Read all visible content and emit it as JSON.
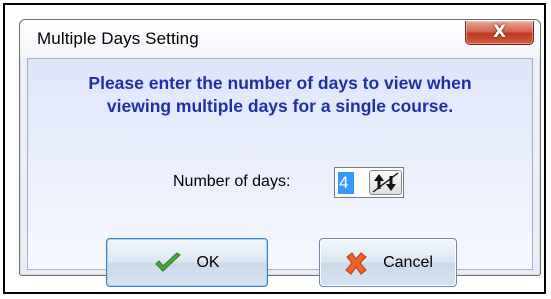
{
  "window": {
    "title": "Multiple Days Setting",
    "close_label": "X"
  },
  "instruction": {
    "line1": "Please enter the number of days to view when",
    "line2": "viewing multiple days for a single course."
  },
  "days": {
    "label": "Number of days:",
    "value": "4"
  },
  "buttons": {
    "ok_label": "OK",
    "cancel_label": "Cancel"
  },
  "icons": {
    "ok": "checkmark-icon",
    "cancel": "x-mark-icon",
    "spinner": "up-down-arrows-icon"
  },
  "colors": {
    "instruction_text": "#1f2fa8",
    "close_button": "#c1391f",
    "selection": "#3399ff"
  }
}
